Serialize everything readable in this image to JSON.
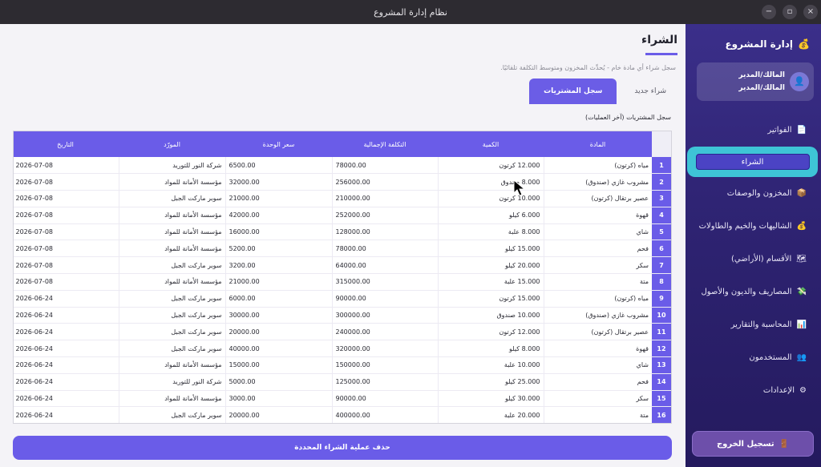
{
  "window": {
    "title": "نظام إدارة المشروع",
    "controls": [
      "−",
      "▫",
      "×"
    ]
  },
  "sidebar": {
    "brand": "إدارة المشروع",
    "brand_icon": "💰",
    "user": {
      "line1": "المالك/المدير",
      "line2": "المالك/المدير",
      "avatar": "👤"
    },
    "items": [
      {
        "label": "الفواتير",
        "icon": "📄"
      },
      {
        "label": "الشراء",
        "icon": "",
        "active": true
      },
      {
        "label": "المخزون والوصفات",
        "icon": "📦"
      },
      {
        "label": "الشاليهات والخيم والطاولات",
        "icon": "💰"
      },
      {
        "label": "الأقسام (الأراضي)",
        "icon": "🗺"
      },
      {
        "label": "المصاريف والديون والأصول",
        "icon": "💸"
      },
      {
        "label": "المحاسبة والتقارير",
        "icon": "📊"
      },
      {
        "label": "المستخدمون",
        "icon": "👥"
      },
      {
        "label": "الإعدادات",
        "icon": "⚙"
      }
    ],
    "logout": {
      "label": "تسجيل الخروج",
      "icon": "🚪"
    }
  },
  "main": {
    "title": "الشراء",
    "subtitle": "سجل شراء أي مادة خام - يُحدِّث المخزون ومتوسط التكلفة تلقائيًا.",
    "tabs": [
      {
        "label": "شراء جديد"
      },
      {
        "label": "سجل المشتريات",
        "active": true
      }
    ],
    "section_label": "سجل المشتريات (آخر العمليات)",
    "table": {
      "headers": [
        "المادة",
        "الكمية",
        "التكلفة الإجمالية",
        "سعر الوحدة",
        "المورّد",
        "التاريخ"
      ],
      "rows": [
        [
          "مياه (كرتون)",
          "12.000 كرتون",
          "78000.00",
          "6500.00",
          "شركة النور للتوريد",
          "2026-07-08"
        ],
        [
          "مشروب غازي (صندوق)",
          "8.000 صندوق",
          "256000.00",
          "32000.00",
          "مؤسسة الأمانة للمواد",
          "2026-07-08"
        ],
        [
          "عصير برتقال (كرتون)",
          "10.000 كرتون",
          "210000.00",
          "21000.00",
          "سوبر ماركت الجبل",
          "2026-07-08"
        ],
        [
          "قهوة",
          "6.000 كيلو",
          "252000.00",
          "42000.00",
          "مؤسسة الأمانة للمواد",
          "2026-07-08"
        ],
        [
          "شاي",
          "8.000 علبة",
          "128000.00",
          "16000.00",
          "مؤسسة الأمانة للمواد",
          "2026-07-08"
        ],
        [
          "فحم",
          "15.000 كيلو",
          "78000.00",
          "5200.00",
          "مؤسسة الأمانة للمواد",
          "2026-07-08"
        ],
        [
          "سكر",
          "20.000 كيلو",
          "64000.00",
          "3200.00",
          "سوبر ماركت الجبل",
          "2026-07-08"
        ],
        [
          "متة",
          "15.000 علبة",
          "315000.00",
          "21000.00",
          "مؤسسة الأمانة للمواد",
          "2026-07-08"
        ],
        [
          "مياه (كرتون)",
          "15.000 كرتون",
          "90000.00",
          "6000.00",
          "سوبر ماركت الجبل",
          "2026-06-24"
        ],
        [
          "مشروب غازي (صندوق)",
          "10.000 صندوق",
          "300000.00",
          "30000.00",
          "سوبر ماركت الجبل",
          "2026-06-24"
        ],
        [
          "عصير برتقال (كرتون)",
          "12.000 كرتون",
          "240000.00",
          "20000.00",
          "سوبر ماركت الجبل",
          "2026-06-24"
        ],
        [
          "قهوة",
          "8.000 كيلو",
          "320000.00",
          "40000.00",
          "سوبر ماركت الجبل",
          "2026-06-24"
        ],
        [
          "شاي",
          "10.000 علبة",
          "150000.00",
          "15000.00",
          "مؤسسة الأمانة للمواد",
          "2026-06-24"
        ],
        [
          "فحم",
          "25.000 كيلو",
          "125000.00",
          "5000.00",
          "شركة النور للتوريد",
          "2026-06-24"
        ],
        [
          "سكر",
          "30.000 كيلو",
          "90000.00",
          "3000.00",
          "مؤسسة الأمانة للمواد",
          "2026-06-24"
        ],
        [
          "متة",
          "20.000 علبة",
          "400000.00",
          "20000.00",
          "سوبر ماركت الجبل",
          "2026-06-24"
        ]
      ]
    },
    "delete_button": "حذف عملية الشراء المحددة"
  },
  "colors": {
    "accent": "#6a5ce8",
    "sidebar": "#2f2474",
    "active_nav": "#3ec4d6"
  }
}
